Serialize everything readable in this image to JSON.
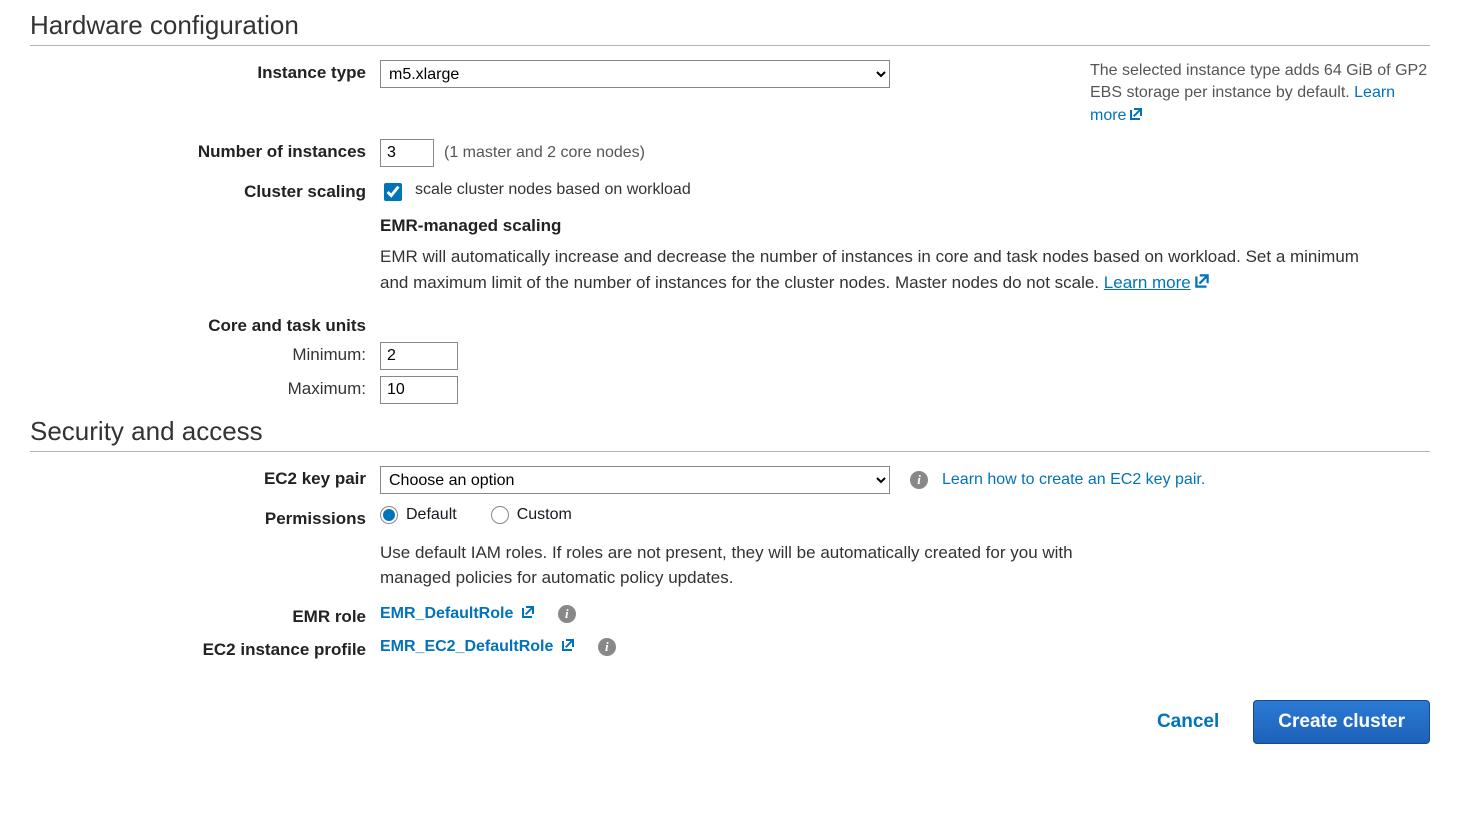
{
  "hardware": {
    "section_title": "Hardware configuration",
    "instance_type": {
      "label": "Instance type",
      "value": "m5.xlarge",
      "hint_prefix": "The selected instance type adds 64 GiB of GP2 EBS storage per instance by default. ",
      "learn_more": "Learn more"
    },
    "instances": {
      "label": "Number of instances",
      "value": "3",
      "hint": "(1 master and 2 core nodes)"
    },
    "scaling": {
      "label": "Cluster scaling",
      "checkbox_label": "scale cluster nodes based on workload",
      "checked": true,
      "managed_title": "EMR-managed scaling",
      "managed_desc": "EMR will automatically increase and decrease the number of instances in core and task nodes based on workload. Set a minimum and maximum limit of the number of instances for the cluster nodes. Master nodes do not scale. ",
      "learn_more": "Learn more"
    },
    "units": {
      "label": "Core and task units",
      "min_label": "Minimum:",
      "min_value": "2",
      "max_label": "Maximum:",
      "max_value": "10"
    }
  },
  "security": {
    "section_title": "Security and access",
    "keypair": {
      "label": "EC2 key pair",
      "placeholder": "Choose an option",
      "help_link": "Learn how to create an EC2 key pair."
    },
    "permissions": {
      "label": "Permissions",
      "options": {
        "default": "Default",
        "custom": "Custom"
      },
      "selected": "default",
      "desc": "Use default IAM roles. If roles are not present, they will be automatically created for you with managed policies for automatic policy updates."
    },
    "emr_role": {
      "label": "EMR role",
      "value": "EMR_DefaultRole"
    },
    "ec2_profile": {
      "label": "EC2 instance profile",
      "value": "EMR_EC2_DefaultRole"
    }
  },
  "footer": {
    "cancel": "Cancel",
    "create": "Create cluster"
  }
}
